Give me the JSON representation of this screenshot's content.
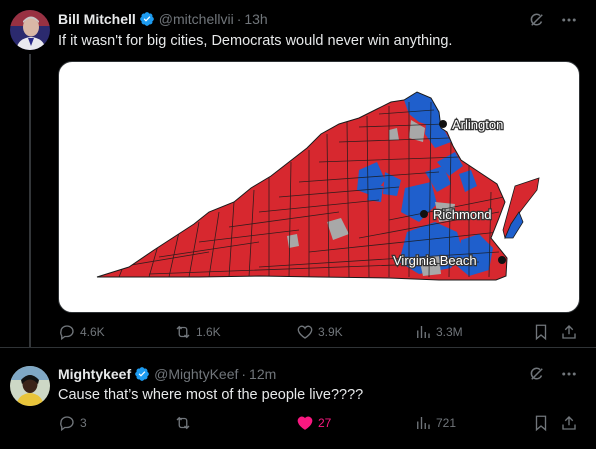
{
  "tweet1": {
    "name": "Bill Mitchell",
    "handle": "@mitchellvii",
    "time": "13h",
    "text": "If it wasn't for big cities, Democrats would never win anything.",
    "replies": "4.6K",
    "reposts": "1.6K",
    "likes": "3.9K",
    "views": "3.3M",
    "map": {
      "labels": {
        "arlington": "Arlington",
        "richmond": "Richmond",
        "vabeach": "Virginia Beach"
      },
      "colors": {
        "red": "#d7282f",
        "blue": "#1f5fcc",
        "gray": "#a8a8a8",
        "border": "#1a1a1a"
      }
    }
  },
  "tweet2": {
    "name": "Mightykeef",
    "handle": "@MightyKeef",
    "time": "12m",
    "text": "Cause that’s where most of the people live????",
    "replies": "3",
    "reposts": "",
    "likes": "27",
    "views": "721"
  },
  "colors": {
    "verified": "#1d9bf0",
    "muted": "#71767b",
    "like": "#f91880"
  },
  "icons": [
    "verified-badge-icon",
    "grok-icon",
    "more-icon",
    "reply-icon",
    "repost-icon",
    "like-icon",
    "views-icon",
    "bookmark-icon",
    "share-icon"
  ]
}
